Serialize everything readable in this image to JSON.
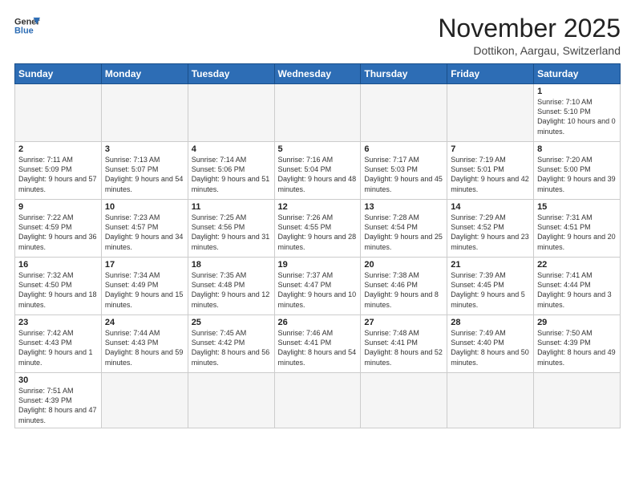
{
  "logo": {
    "line1": "General",
    "line2": "Blue"
  },
  "title": "November 2025",
  "subtitle": "Dottikon, Aargau, Switzerland",
  "days_header": [
    "Sunday",
    "Monday",
    "Tuesday",
    "Wednesday",
    "Thursday",
    "Friday",
    "Saturday"
  ],
  "weeks": [
    [
      {
        "day": "",
        "info": ""
      },
      {
        "day": "",
        "info": ""
      },
      {
        "day": "",
        "info": ""
      },
      {
        "day": "",
        "info": ""
      },
      {
        "day": "",
        "info": ""
      },
      {
        "day": "",
        "info": ""
      },
      {
        "day": "1",
        "info": "Sunrise: 7:10 AM\nSunset: 5:10 PM\nDaylight: 10 hours\nand 0 minutes."
      }
    ],
    [
      {
        "day": "2",
        "info": "Sunrise: 7:11 AM\nSunset: 5:09 PM\nDaylight: 9 hours\nand 57 minutes."
      },
      {
        "day": "3",
        "info": "Sunrise: 7:13 AM\nSunset: 5:07 PM\nDaylight: 9 hours\nand 54 minutes."
      },
      {
        "day": "4",
        "info": "Sunrise: 7:14 AM\nSunset: 5:06 PM\nDaylight: 9 hours\nand 51 minutes."
      },
      {
        "day": "5",
        "info": "Sunrise: 7:16 AM\nSunset: 5:04 PM\nDaylight: 9 hours\nand 48 minutes."
      },
      {
        "day": "6",
        "info": "Sunrise: 7:17 AM\nSunset: 5:03 PM\nDaylight: 9 hours\nand 45 minutes."
      },
      {
        "day": "7",
        "info": "Sunrise: 7:19 AM\nSunset: 5:01 PM\nDaylight: 9 hours\nand 42 minutes."
      },
      {
        "day": "8",
        "info": "Sunrise: 7:20 AM\nSunset: 5:00 PM\nDaylight: 9 hours\nand 39 minutes."
      }
    ],
    [
      {
        "day": "9",
        "info": "Sunrise: 7:22 AM\nSunset: 4:59 PM\nDaylight: 9 hours\nand 36 minutes."
      },
      {
        "day": "10",
        "info": "Sunrise: 7:23 AM\nSunset: 4:57 PM\nDaylight: 9 hours\nand 34 minutes."
      },
      {
        "day": "11",
        "info": "Sunrise: 7:25 AM\nSunset: 4:56 PM\nDaylight: 9 hours\nand 31 minutes."
      },
      {
        "day": "12",
        "info": "Sunrise: 7:26 AM\nSunset: 4:55 PM\nDaylight: 9 hours\nand 28 minutes."
      },
      {
        "day": "13",
        "info": "Sunrise: 7:28 AM\nSunset: 4:54 PM\nDaylight: 9 hours\nand 25 minutes."
      },
      {
        "day": "14",
        "info": "Sunrise: 7:29 AM\nSunset: 4:52 PM\nDaylight: 9 hours\nand 23 minutes."
      },
      {
        "day": "15",
        "info": "Sunrise: 7:31 AM\nSunset: 4:51 PM\nDaylight: 9 hours\nand 20 minutes."
      }
    ],
    [
      {
        "day": "16",
        "info": "Sunrise: 7:32 AM\nSunset: 4:50 PM\nDaylight: 9 hours\nand 18 minutes."
      },
      {
        "day": "17",
        "info": "Sunrise: 7:34 AM\nSunset: 4:49 PM\nDaylight: 9 hours\nand 15 minutes."
      },
      {
        "day": "18",
        "info": "Sunrise: 7:35 AM\nSunset: 4:48 PM\nDaylight: 9 hours\nand 12 minutes."
      },
      {
        "day": "19",
        "info": "Sunrise: 7:37 AM\nSunset: 4:47 PM\nDaylight: 9 hours\nand 10 minutes."
      },
      {
        "day": "20",
        "info": "Sunrise: 7:38 AM\nSunset: 4:46 PM\nDaylight: 9 hours\nand 8 minutes."
      },
      {
        "day": "21",
        "info": "Sunrise: 7:39 AM\nSunset: 4:45 PM\nDaylight: 9 hours\nand 5 minutes."
      },
      {
        "day": "22",
        "info": "Sunrise: 7:41 AM\nSunset: 4:44 PM\nDaylight: 9 hours\nand 3 minutes."
      }
    ],
    [
      {
        "day": "23",
        "info": "Sunrise: 7:42 AM\nSunset: 4:43 PM\nDaylight: 9 hours\nand 1 minute."
      },
      {
        "day": "24",
        "info": "Sunrise: 7:44 AM\nSunset: 4:43 PM\nDaylight: 8 hours\nand 59 minutes."
      },
      {
        "day": "25",
        "info": "Sunrise: 7:45 AM\nSunset: 4:42 PM\nDaylight: 8 hours\nand 56 minutes."
      },
      {
        "day": "26",
        "info": "Sunrise: 7:46 AM\nSunset: 4:41 PM\nDaylight: 8 hours\nand 54 minutes."
      },
      {
        "day": "27",
        "info": "Sunrise: 7:48 AM\nSunset: 4:41 PM\nDaylight: 8 hours\nand 52 minutes."
      },
      {
        "day": "28",
        "info": "Sunrise: 7:49 AM\nSunset: 4:40 PM\nDaylight: 8 hours\nand 50 minutes."
      },
      {
        "day": "29",
        "info": "Sunrise: 7:50 AM\nSunset: 4:39 PM\nDaylight: 8 hours\nand 49 minutes."
      }
    ],
    [
      {
        "day": "30",
        "info": "Sunrise: 7:51 AM\nSunset: 4:39 PM\nDaylight: 8 hours\nand 47 minutes."
      },
      {
        "day": "",
        "info": ""
      },
      {
        "day": "",
        "info": ""
      },
      {
        "day": "",
        "info": ""
      },
      {
        "day": "",
        "info": ""
      },
      {
        "day": "",
        "info": ""
      },
      {
        "day": "",
        "info": ""
      }
    ]
  ]
}
